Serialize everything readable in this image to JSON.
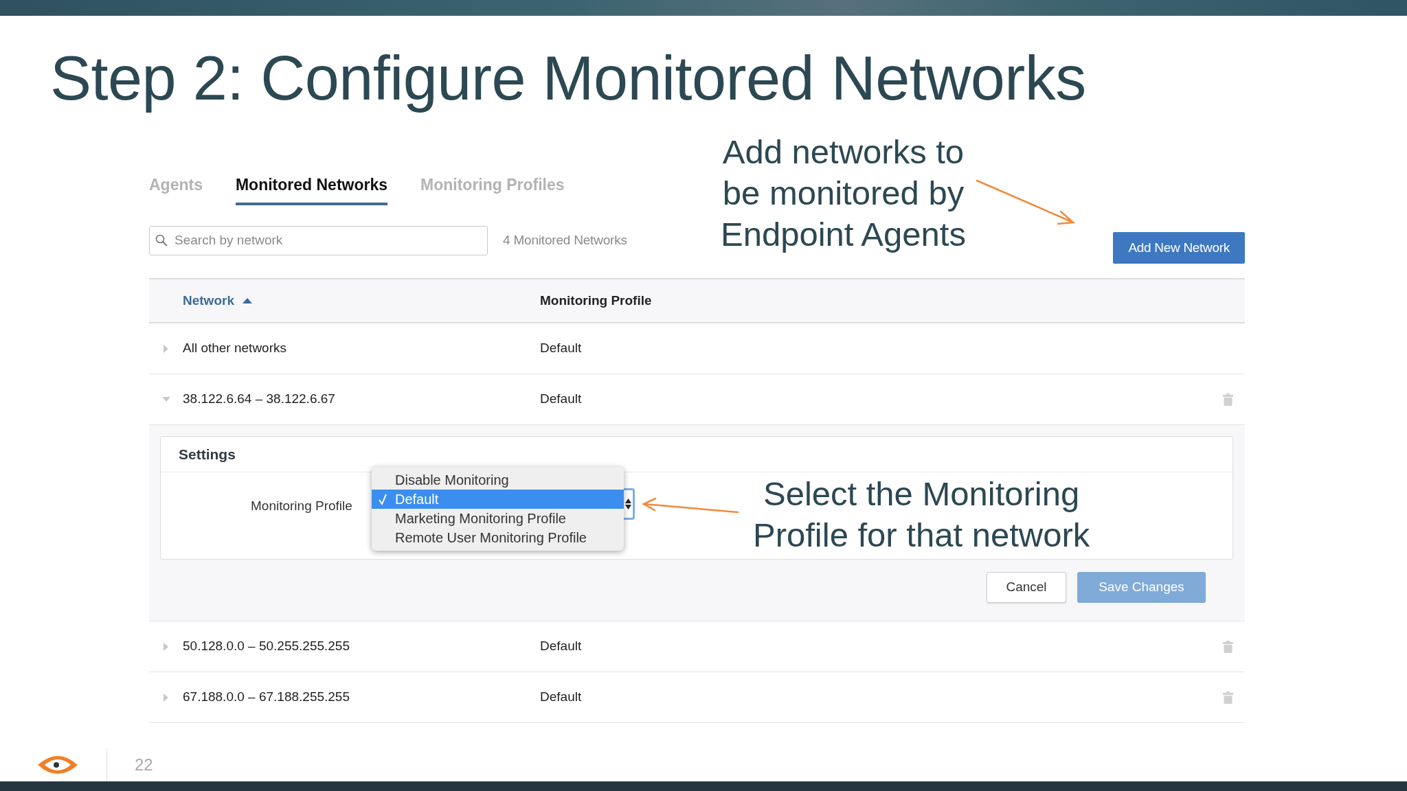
{
  "slide": {
    "title": "Step 2: Configure Monitored Networks",
    "page_number": "22"
  },
  "tabs": [
    {
      "label": "Agents",
      "selected": false
    },
    {
      "label": "Monitored Networks",
      "selected": true
    },
    {
      "label": "Monitoring Profiles",
      "selected": false
    }
  ],
  "search": {
    "placeholder": "Search by network"
  },
  "count": "4 Monitored Networks",
  "add_button": "Add New Network",
  "annotations": [
    {
      "lines": [
        "Add networks to",
        "be monitored by",
        "Endpoint Agents"
      ]
    },
    {
      "lines": [
        "Select the Monitoring",
        "Profile for that network"
      ]
    }
  ],
  "table": {
    "columns": [
      {
        "label": "Network",
        "sorted": true
      },
      {
        "label": "Monitoring Profile",
        "sorted": false
      }
    ],
    "rows": [
      {
        "network": "All other networks",
        "profile": "Default",
        "expanded": false,
        "deletable": false
      },
      {
        "network": "38.122.6.64 – 38.122.6.67",
        "profile": "Default",
        "expanded": true,
        "deletable": true
      },
      {
        "network": "50.128.0.0 – 50.255.255.255",
        "profile": "Default",
        "expanded": false,
        "deletable": true
      },
      {
        "network": "67.188.0.0 – 67.188.255.255",
        "profile": "Default",
        "expanded": false,
        "deletable": true
      }
    ]
  },
  "settings": {
    "title": "Settings",
    "field_label": "Monitoring Profile",
    "options": [
      {
        "label": "Disable Monitoring",
        "selected": false
      },
      {
        "label": "Default",
        "selected": true
      },
      {
        "label": "Marketing Monitoring Profile",
        "selected": false
      },
      {
        "label": "Remote User Monitoring Profile",
        "selected": false
      }
    ],
    "buttons": [
      {
        "label": "Cancel",
        "kind": "secondary",
        "disabled": false
      },
      {
        "label": "Save Changes",
        "kind": "primary",
        "disabled": true
      }
    ]
  }
}
